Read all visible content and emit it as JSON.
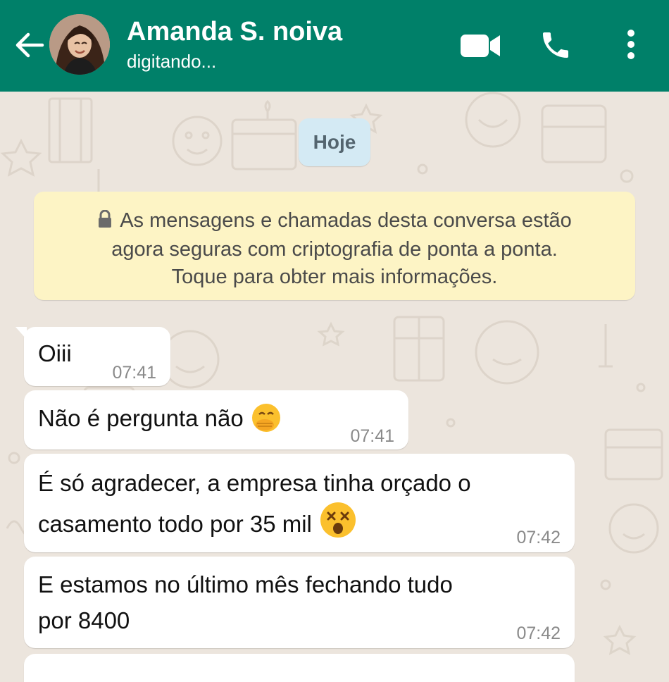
{
  "header": {
    "contact_name": "Amanda S. noiva",
    "status": "digitando..."
  },
  "chat": {
    "date_label": "Hoje",
    "encryption_notice": [
      "As mensagens e chamadas desta conversa estão",
      "agora seguras com criptografia de ponta a ponta.",
      "Toque para obter mais informações."
    ],
    "messages": [
      {
        "lines": [
          "Oiii"
        ],
        "time": "07:41",
        "emoji": ""
      },
      {
        "lines": [
          "Não é pergunta não"
        ],
        "time": "07:41",
        "emoji": "hand-over-mouth"
      },
      {
        "lines": [
          "É só agradecer, a empresa tinha orçado o",
          "casamento todo por 35 mil"
        ],
        "time": "07:42",
        "emoji": "dizzy-face"
      },
      {
        "lines": [
          "E estamos no último mês fechando tudo",
          "por 8400"
        ],
        "time": "07:42",
        "emoji": ""
      }
    ]
  },
  "colors": {
    "header": "#008069",
    "background": "#ece5dd",
    "incoming_bubble": "#ffffff",
    "date_chip": "#d4eaf4",
    "encryption_banner": "#fdf4c5"
  },
  "icons": [
    "back-arrow-icon",
    "video-call-icon",
    "phone-icon",
    "more-vertical-icon",
    "lock-icon"
  ]
}
